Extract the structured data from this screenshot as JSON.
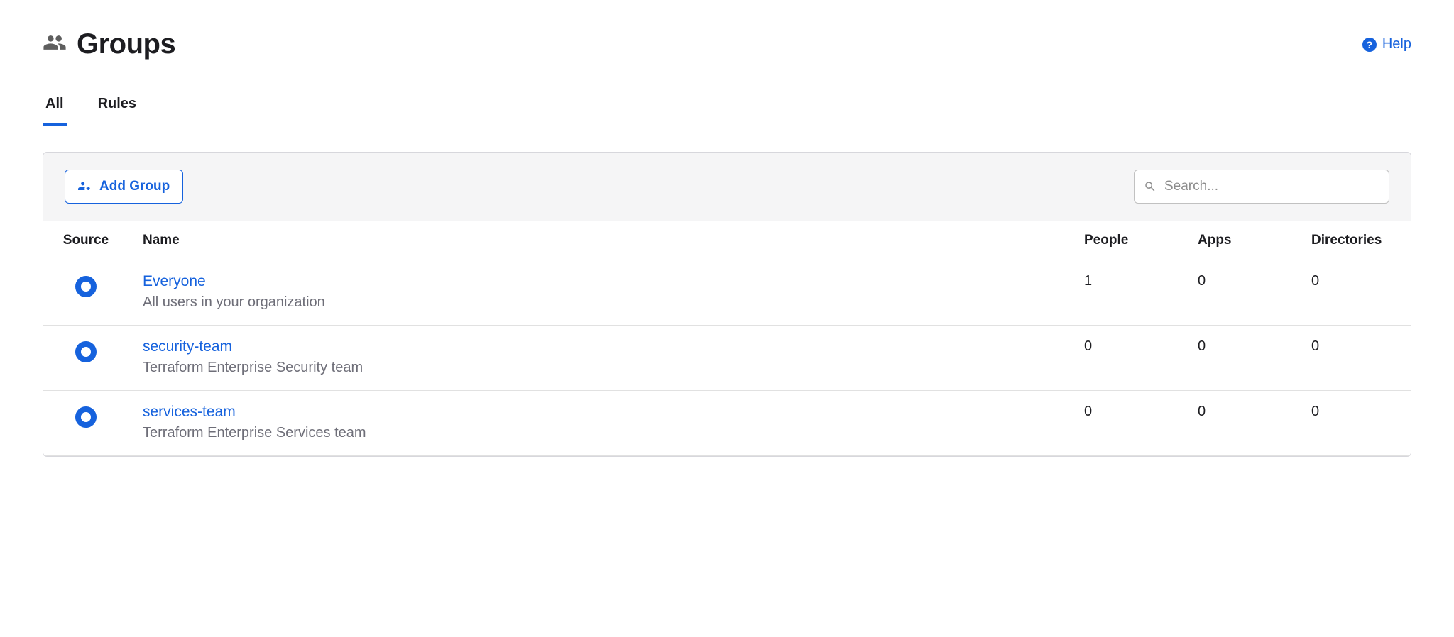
{
  "header": {
    "title": "Groups",
    "help_label": "Help"
  },
  "tabs": {
    "all": "All",
    "rules": "Rules"
  },
  "toolbar": {
    "add_group_label": "Add Group",
    "search_placeholder": "Search..."
  },
  "columns": {
    "source": "Source",
    "name": "Name",
    "people": "People",
    "apps": "Apps",
    "directories": "Directories"
  },
  "rows": [
    {
      "name": "Everyone",
      "desc": "All users in your organization",
      "people": "1",
      "apps": "0",
      "directories": "0"
    },
    {
      "name": "security-team",
      "desc": "Terraform Enterprise Security team",
      "people": "0",
      "apps": "0",
      "directories": "0"
    },
    {
      "name": "services-team",
      "desc": "Terraform Enterprise Services team",
      "people": "0",
      "apps": "0",
      "directories": "0"
    }
  ]
}
